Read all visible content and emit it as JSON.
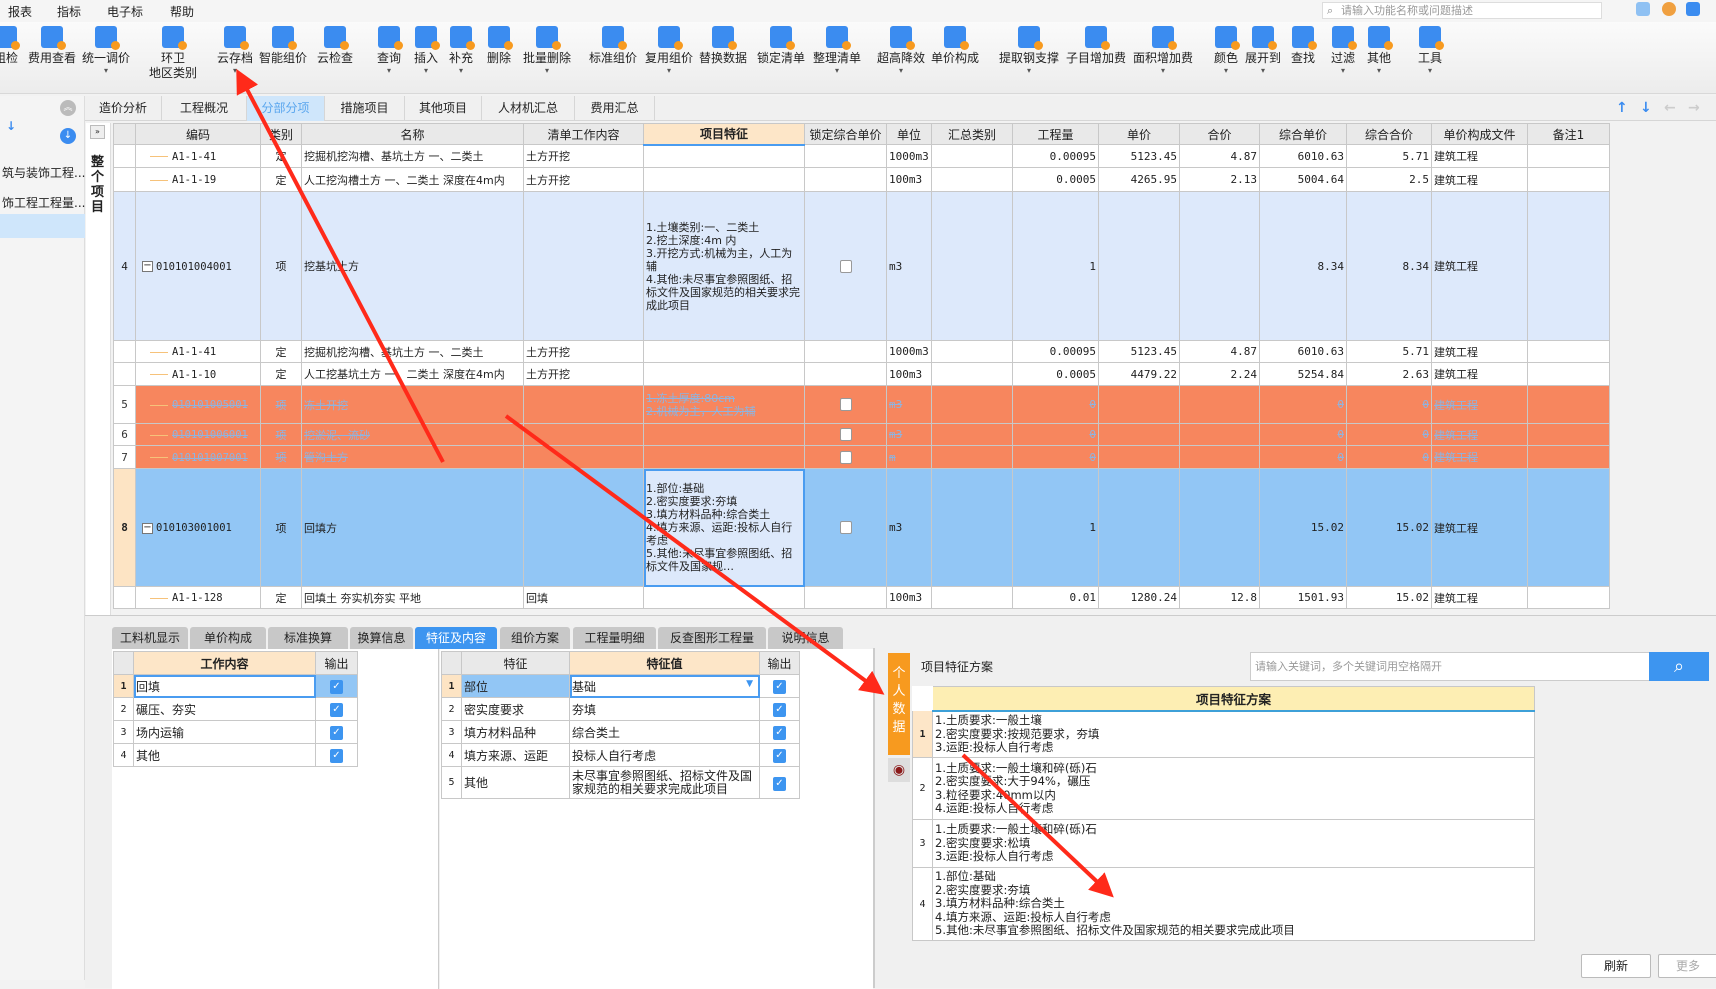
{
  "menu": [
    "报表",
    "指标",
    "电子标",
    "帮助"
  ],
  "top_search_placeholder": "请输入功能名称或问题描述",
  "toolbar": [
    {
      "label": "组检",
      "icon": "check-icon",
      "dropdown": false
    },
    {
      "label": "费用查看",
      "icon": "fee-view-icon",
      "dropdown": false
    },
    {
      "label": "统一调价",
      "icon": "adjust-price-icon",
      "dropdown": true
    },
    {
      "label": "环卫",
      "label2": "地区类别",
      "icon": "region-icon",
      "dropdown": false
    },
    {
      "label": "云存档",
      "icon": "cloud-upload-icon",
      "dropdown": true
    },
    {
      "label": "智能组价",
      "icon": "smart-price-icon",
      "dropdown": false
    },
    {
      "label": "云检查",
      "icon": "cloud-check-icon",
      "dropdown": false
    },
    {
      "label": "查询",
      "icon": "query-icon",
      "dropdown": true
    },
    {
      "label": "插入",
      "icon": "insert-icon",
      "dropdown": true
    },
    {
      "label": "补充",
      "icon": "supplement-icon",
      "dropdown": true
    },
    {
      "label": "删除",
      "icon": "trash-icon",
      "dropdown": false
    },
    {
      "label": "批量删除",
      "icon": "batch-delete-icon",
      "dropdown": true
    },
    {
      "label": "标准组价",
      "icon": "standard-price-icon",
      "dropdown": false
    },
    {
      "label": "复用组价",
      "icon": "reuse-price-icon",
      "dropdown": true
    },
    {
      "label": "替换数据",
      "icon": "replace-data-icon",
      "dropdown": false
    },
    {
      "label": "锁定清单",
      "icon": "lock-icon",
      "dropdown": false
    },
    {
      "label": "整理清单",
      "icon": "organize-list-icon",
      "dropdown": true
    },
    {
      "label": "超高降效",
      "icon": "height-efficiency-icon",
      "dropdown": true
    },
    {
      "label": "单价构成",
      "icon": "price-composition-icon",
      "dropdown": false
    },
    {
      "label": "提取钢支撑",
      "icon": "steel-support-icon",
      "dropdown": true
    },
    {
      "label": "子目增加费",
      "icon": "subitem-fee-icon",
      "dropdown": false
    },
    {
      "label": "面积增加费",
      "icon": "area-fee-icon",
      "dropdown": true
    },
    {
      "label": "颜色",
      "icon": "color-icon",
      "dropdown": true
    },
    {
      "label": "展开到",
      "icon": "expand-icon",
      "dropdown": true
    },
    {
      "label": "查找",
      "icon": "find-icon",
      "dropdown": false
    },
    {
      "label": "过滤",
      "icon": "filter-icon",
      "dropdown": true
    },
    {
      "label": "其他",
      "icon": "other-icon",
      "dropdown": true
    },
    {
      "label": "工具",
      "icon": "tools-icon",
      "dropdown": true
    }
  ],
  "tabs": [
    {
      "label": "造价分析",
      "active": false
    },
    {
      "label": "工程概况",
      "active": false
    },
    {
      "label": "分部分项",
      "active": true
    },
    {
      "label": "措施项目",
      "active": false
    },
    {
      "label": "其他项目",
      "active": false
    },
    {
      "label": "人材机汇总",
      "active": false
    },
    {
      "label": "费用汇总",
      "active": false
    }
  ],
  "sidebar": {
    "items": [
      "筑与装饰工程...",
      "饰工程工程量...",
      ""
    ],
    "vertical_label": "整个项目"
  },
  "table": {
    "columns": [
      "",
      "编码",
      "类别",
      "名称",
      "清单工作内容",
      "项目特征",
      "锁定综合单价",
      "单位",
      "汇总类别",
      "工程量",
      "单价",
      "合价",
      "综合单价",
      "综合合价",
      "单价构成文件",
      "备注1"
    ],
    "rows": [
      {
        "num": "",
        "code": "A1-1-41",
        "type": "定",
        "name": "挖掘机挖沟槽、基坑土方 一、二类土",
        "work": "土方开挖",
        "feature": "",
        "lock": null,
        "unit": "1000m3",
        "sum_cat": "",
        "qty": "0.00095",
        "price": "5123.45",
        "total": "4.87",
        "comp_price": "6010.63",
        "comp_total": "5.71",
        "file": "建筑工程",
        "note": "",
        "kind": "sub",
        "state": "normal"
      },
      {
        "num": "",
        "code": "A1-1-19",
        "type": "定",
        "name": "人工挖沟槽土方 一、二类土 深度在4m内",
        "work": "土方开挖",
        "feature": "",
        "lock": null,
        "unit": "100m3",
        "sum_cat": "",
        "qty": "0.0005",
        "price": "4265.95",
        "total": "2.13",
        "comp_price": "5004.64",
        "comp_total": "2.5",
        "file": "建筑工程",
        "note": "",
        "kind": "sub",
        "state": "normal"
      },
      {
        "num": "4",
        "code": "010101004001",
        "type": "项",
        "name": "挖基坑土方",
        "work": "",
        "feature": "1.土壤类别:一、二类土\n2.挖土深度:4m 内\n3.开挖方式:机械为主，人工为辅\n4.其他:未尽事宜参照图纸、招标文件及国家规范的相关要求完成此项目",
        "lock": false,
        "unit": "m3",
        "sum_cat": "",
        "qty": "1",
        "price": "",
        "total": "",
        "comp_price": "8.34",
        "comp_total": "8.34",
        "file": "建筑工程",
        "note": "",
        "kind": "item",
        "state": "highlight"
      },
      {
        "num": "",
        "code": "A1-1-41",
        "type": "定",
        "name": "挖掘机挖沟槽、基坑土方 一、二类土",
        "work": "土方开挖",
        "feature": "",
        "lock": null,
        "unit": "1000m3",
        "sum_cat": "",
        "qty": "0.00095",
        "price": "5123.45",
        "total": "4.87",
        "comp_price": "6010.63",
        "comp_total": "5.71",
        "file": "建筑工程",
        "note": "",
        "kind": "sub",
        "state": "normal"
      },
      {
        "num": "",
        "code": "A1-1-10",
        "type": "定",
        "name": "人工挖基坑土方 一、二类土 深度在4m内",
        "work": "土方开挖",
        "feature": "",
        "lock": null,
        "unit": "100m3",
        "sum_cat": "",
        "qty": "0.0005",
        "price": "4479.22",
        "total": "2.24",
        "comp_price": "5254.84",
        "comp_total": "2.63",
        "file": "建筑工程",
        "note": "",
        "kind": "sub",
        "state": "normal"
      },
      {
        "num": "5",
        "code": "010101005001",
        "type": "项",
        "name": "冻土开挖",
        "work": "",
        "feature": "1.冻土厚度:80cm\n2.机械为主，人工为辅",
        "lock": false,
        "unit": "m3",
        "sum_cat": "",
        "qty": "0",
        "price": "",
        "total": "",
        "comp_price": "0",
        "comp_total": "0",
        "file": "建筑工程",
        "note": "",
        "kind": "flat",
        "state": "deleted"
      },
      {
        "num": "6",
        "code": "010101006001",
        "type": "项",
        "name": "挖淤泥、流砂",
        "work": "",
        "feature": "",
        "lock": false,
        "unit": "m3",
        "sum_cat": "",
        "qty": "0",
        "price": "",
        "total": "",
        "comp_price": "0",
        "comp_total": "0",
        "file": "建筑工程",
        "note": "",
        "kind": "flat",
        "state": "deleted"
      },
      {
        "num": "7",
        "code": "010101007001",
        "type": "项",
        "name": "管沟土方",
        "work": "",
        "feature": "",
        "lock": false,
        "unit": "m",
        "sum_cat": "",
        "qty": "0",
        "price": "",
        "total": "",
        "comp_price": "0",
        "comp_total": "0",
        "file": "建筑工程",
        "note": "",
        "kind": "flat",
        "state": "deleted"
      },
      {
        "num": "8",
        "code": "010103001001",
        "type": "项",
        "name": "回填方",
        "work": "",
        "feature": "1.部位:基础\n2.密实度要求:夯填\n3.填方材料品种:综合类土\n4.填方来源、运距:投标人自行考虑\n5.其他:未尽事宜参照图纸、招标文件及国家规…",
        "lock": false,
        "unit": "m3",
        "sum_cat": "",
        "qty": "1",
        "price": "",
        "total": "",
        "comp_price": "15.02",
        "comp_total": "15.02",
        "file": "建筑工程",
        "note": "",
        "kind": "item",
        "state": "selected"
      },
      {
        "num": "",
        "code": "A1-1-128",
        "type": "定",
        "name": "回填土 夯实机夯实 平地",
        "work": "回填",
        "feature": "",
        "lock": null,
        "unit": "100m3",
        "sum_cat": "",
        "qty": "0.01",
        "price": "1280.24",
        "total": "12.8",
        "comp_price": "1501.93",
        "comp_total": "15.02",
        "file": "建筑工程",
        "note": "",
        "kind": "sub",
        "state": "normal"
      }
    ]
  },
  "bottom_tabs": [
    {
      "label": "工料机显示",
      "active": false
    },
    {
      "label": "单价构成",
      "active": false
    },
    {
      "label": "标准换算",
      "active": false
    },
    {
      "label": "换算信息",
      "active": false
    },
    {
      "label": "特征及内容",
      "active": true
    },
    {
      "label": "组价方案",
      "active": false
    },
    {
      "label": "工程量明细",
      "active": false
    },
    {
      "label": "反查图形工程量",
      "active": false
    },
    {
      "label": "说明信息",
      "active": false
    }
  ],
  "work_content": {
    "headers": [
      "工作内容",
      "输出"
    ],
    "rows": [
      {
        "num": "1",
        "text": "回填",
        "output": true
      },
      {
        "num": "2",
        "text": "碾压、夯实",
        "output": true
      },
      {
        "num": "3",
        "text": "场内运输",
        "output": true
      },
      {
        "num": "4",
        "text": "其他",
        "output": true
      }
    ]
  },
  "features": {
    "headers": [
      "特征",
      "特征值",
      "输出"
    ],
    "rows": [
      {
        "num": "1",
        "name": "部位",
        "value": "基础",
        "output": true
      },
      {
        "num": "2",
        "name": "密实度要求",
        "value": "夯填",
        "output": true
      },
      {
        "num": "3",
        "name": "填方材料品种",
        "value": "综合类土",
        "output": true
      },
      {
        "num": "4",
        "name": "填方来源、运距",
        "value": "投标人自行考虑",
        "output": true
      },
      {
        "num": "5",
        "name": "其他",
        "value": "未尽事宜参照图纸、招标文件及国\n家规范的相关要求完成此项目",
        "output": true
      }
    ]
  },
  "scheme": {
    "side_tab": "个人数据",
    "label": "项目特征方案",
    "search_placeholder": "请输入关键词，多个关键词用空格隔开",
    "header": "项目特征方案",
    "rows": [
      {
        "num": "1",
        "text": "1.土质要求:一般土壤\n2.密实度要求:按规范要求，夯填\n3.运距:投标人自行考虑"
      },
      {
        "num": "2",
        "text": "1.土质要求:一般土壤和碎(砾)石\n2.密实度要求:大于94%，碾压\n3.粒径要求:40mm以内\n4.运距:投标人自行考虑"
      },
      {
        "num": "3",
        "text": "1.土质要求:一般土壤和碎(砾)石\n2.密实度要求:松填\n3.运距:投标人自行考虑"
      },
      {
        "num": "4",
        "text": "1.部位:基础\n2.密实度要求:夯填\n3.填方材料品种:综合类土\n4.填方来源、运距:投标人自行考虑\n5.其他:未尽事宜参照图纸、招标文件及国家规范的相关要求完成此项目"
      }
    ],
    "refresh_label": "刷新",
    "more_label": "更多"
  },
  "colors": {
    "accent": "#3d95f0",
    "deleted_row": "#f7865e",
    "selected_row": "#92c6f5",
    "highlight_row": "#dde9fb",
    "annotation": "#ff2a1a"
  }
}
